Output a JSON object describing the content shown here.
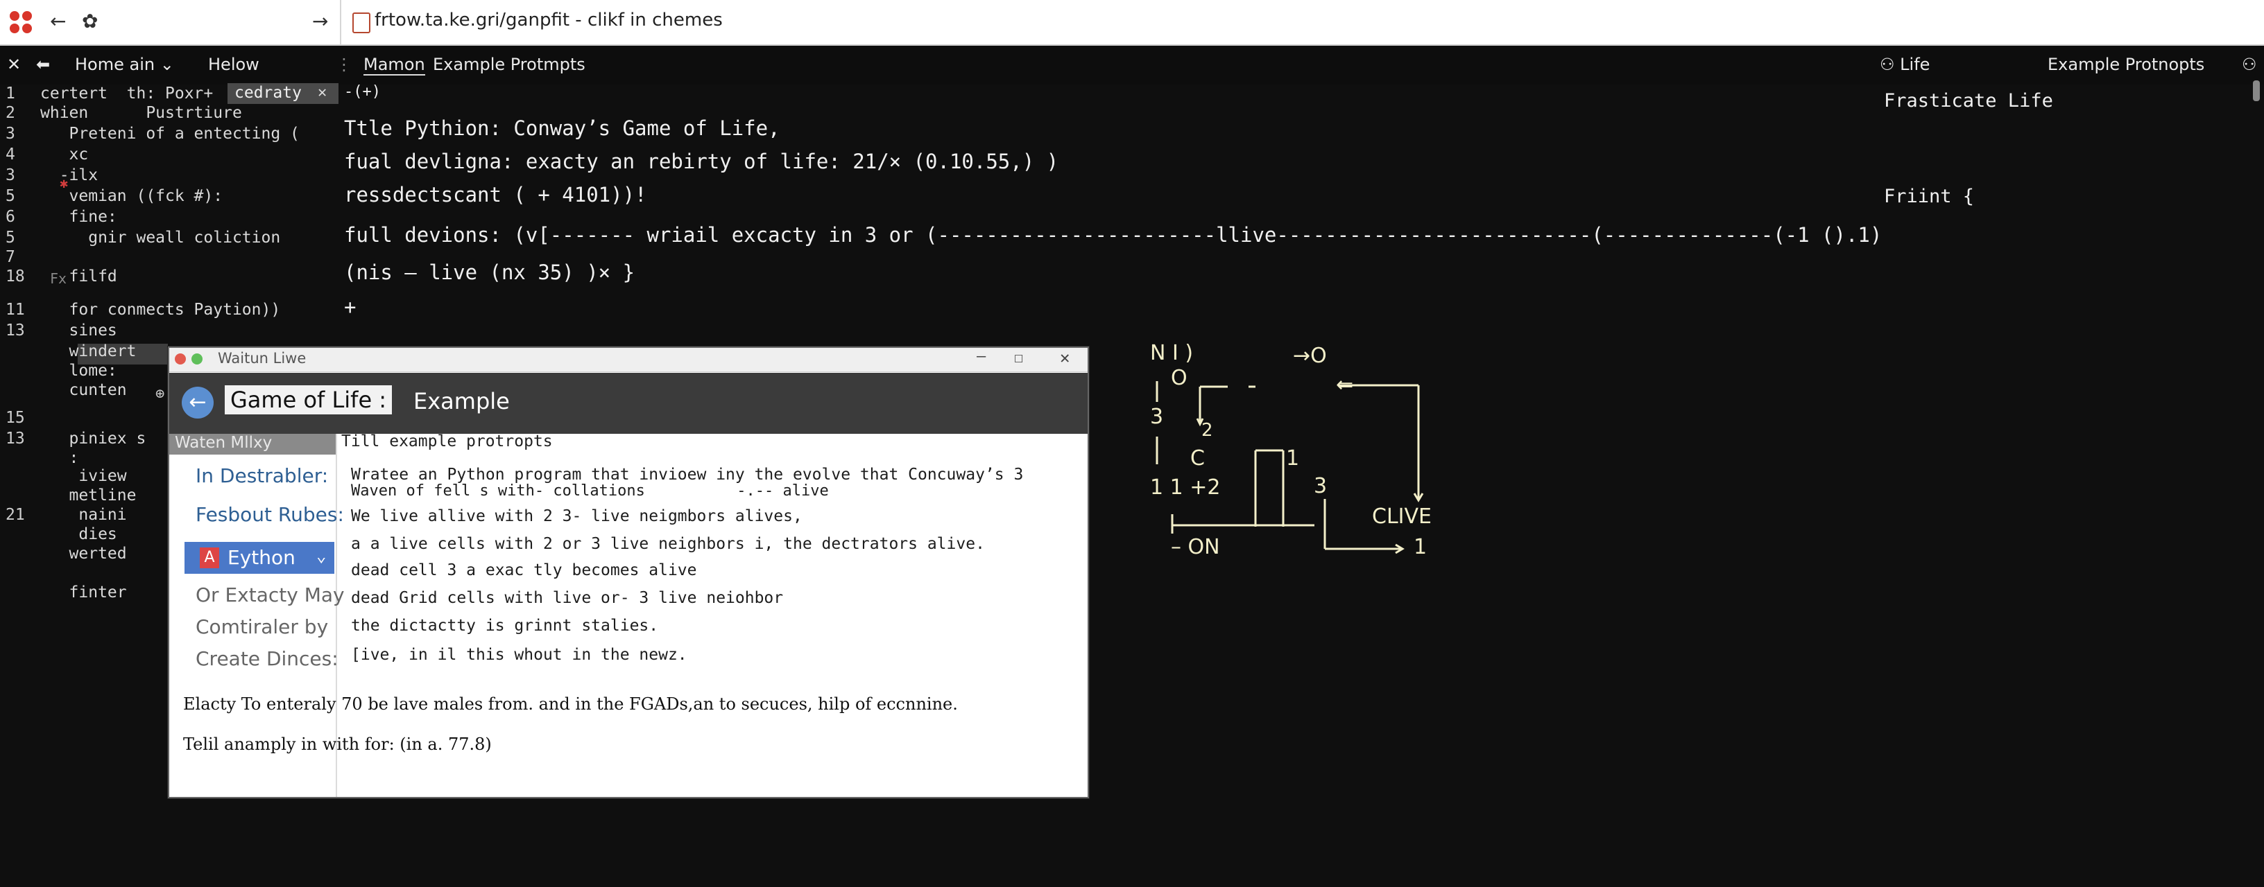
{
  "browser": {
    "url": "frtow.ta.ke.gri/ganpfit - clikf in chemes"
  },
  "menu": {
    "home": "Home ain",
    "help": "Helow",
    "tab_active": "Mamon",
    "tab_2": "Example Protmpts",
    "right_tab_1": "Life",
    "right_tab_2": "Example Protnopts"
  },
  "file_panel": {
    "lines": [
      {
        "n": "1",
        "text": "certert  th: Poxr+"
      },
      {
        "n": "2",
        "text": "whien      Pustrtiure"
      },
      {
        "n": "3",
        "text": "   Preteni of a entecting ("
      },
      {
        "n": "4",
        "text": "   xc"
      },
      {
        "n": "3",
        "text": "  -ilx"
      },
      {
        "n": "5",
        "text": "   vemian ((fck #):"
      },
      {
        "n": "6",
        "text": "   fine:"
      },
      {
        "n": "5",
        "text": "     gnir weall coliction"
      },
      {
        "n": "7",
        "text": ""
      },
      {
        "n": "18",
        "text": "   filfd"
      },
      {
        "n": "11",
        "text": "   for conmects Paytion))"
      },
      {
        "n": "13",
        "text": "   sines"
      },
      {
        "n": "",
        "text": "   windert"
      },
      {
        "n": "",
        "text": "   lome:"
      },
      {
        "n": "",
        "text": "   cunten"
      },
      {
        "n": "15",
        "text": ""
      },
      {
        "n": "13",
        "text": "   piniex s"
      },
      {
        "n": "",
        "text": "   :"
      },
      {
        "n": "",
        "text": "    iview"
      },
      {
        "n": "",
        "text": "   metline"
      },
      {
        "n": "21",
        "text": "    naini"
      },
      {
        "n": "",
        "text": "    dies"
      },
      {
        "n": "",
        "text": "   werted"
      },
      {
        "n": "",
        "text": ""
      },
      {
        "n": "",
        "text": "   finter"
      }
    ],
    "open_tab": "cedraty",
    "fx_marker": "Fx"
  },
  "main": {
    "tab_prefix": "-(+)",
    "lines": [
      "Ttle Pythion: Conway’s Game of Life,",
      "fual devligna: exacty an rebirty of life: 21/× (0.10.55,) )",
      "ressdectscant ( + 4101))!",
      "full devions: (v[------- wriail excacty in 3 or (-----------------------llive--------------------------(--------------(-1 ().1)",
      "(nis – live (nx 35) )× }",
      "+"
    ]
  },
  "right_col": {
    "heading": "Frasticate Life",
    "code": "Friint {"
  },
  "diagram": {
    "labels": [
      "N I )",
      "O",
      "1",
      "3",
      "2",
      "C",
      "1 1 +2",
      "1",
      "3",
      "→O",
      "CLIVE",
      "– ON",
      "1"
    ]
  },
  "window": {
    "title": "Waitun Liwe",
    "header_game": "Game of Life :",
    "header_example": "Example",
    "subtab": "Waten Mllxy",
    "subtab_right": "Till example protropts",
    "left_labels": {
      "destrabler": "In Destrabler:",
      "fesbout": "Fesbout Rubes:",
      "dropdown": "Eython",
      "exacty": "Or Extacty May",
      "comtraler": "Comtiraler by",
      "create": "Create Dinces:"
    },
    "right_lines": [
      "Wratee an Python program that invioew iny the evolve that Concuway’s 3",
      "Waven of fell s with- collations          -.-- alive",
      "We live allive with 2 3- live neigmbors alives,",
      "a a live cells with 2 or 3 live neighbors i, the dectrators alive.",
      "dead cell 3 a exac tly becomes alive",
      "dead Grid cells with live or- 3 live neiohbor",
      "the dictactty is grinnt stalies.",
      "[ive, in il this whout in the newz."
    ],
    "footer_1": "Elacty To enteraly 70 be lave males from. and in the FGADs,an to secuces, hilp of eccnnine.",
    "footer_2": "Telil anamply in with for: (in a. 77.8)"
  }
}
